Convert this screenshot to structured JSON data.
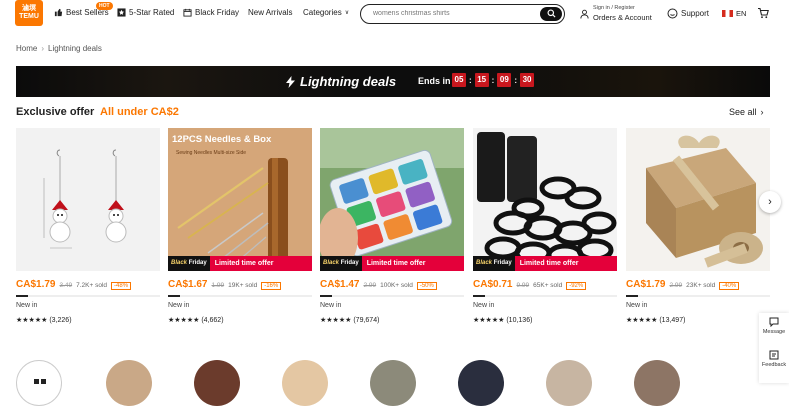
{
  "header": {
    "logo_lines": [
      "滷塓",
      "TEMU"
    ],
    "hot_badge": "HOT",
    "nav": {
      "best_sellers": "Best Sellers",
      "five_star": "5-Star Rated",
      "black_friday": "Black Friday",
      "new_arrivals": "New Arrivals",
      "categories": "Categories"
    },
    "search": {
      "value": "womens christmas shirts"
    },
    "account": {
      "line1": "Sign in / Register",
      "line2": "Orders & Account"
    },
    "support": "Support",
    "language": "EN"
  },
  "breadcrumb": {
    "home": "Home",
    "current": "Lightning deals"
  },
  "banner": {
    "title": "Lightning deals",
    "ends_label": "Ends in",
    "timer": [
      "05",
      "15",
      "09",
      "30"
    ]
  },
  "section": {
    "title": "Exclusive offer",
    "subtitle": "All under CA$2",
    "see_all": "See all"
  },
  "badge": {
    "black": "Black",
    "friday": "Friday",
    "offer": "Limited time offer"
  },
  "products": [
    {
      "price": "CA$1.79",
      "orig": "3.49",
      "sold": "7.2K+ sold",
      "discount": "-48%",
      "new_in": "New in",
      "stars": "★★★★★",
      "reviews": "(3,226)",
      "promo": false,
      "sale_bar": 0.08
    },
    {
      "price": "CA$1.67",
      "orig": "1.99",
      "sold": "19K+ sold",
      "discount": "-16%",
      "new_in": "New in",
      "stars": "★★★★★",
      "reviews": "(4,662)",
      "promo": true,
      "sale_bar": 0.08,
      "img_title": "12PCS Needles & Box",
      "img_sub": "Sewing Needles Multi-size Side"
    },
    {
      "price": "CA$1.47",
      "orig": "2.99",
      "sold": "100K+ sold",
      "discount": "-50%",
      "new_in": "New in",
      "stars": "★★★★★",
      "reviews": "(79,674)",
      "promo": true,
      "sale_bar": 0.08
    },
    {
      "price": "CA$0.71",
      "orig": "9.99",
      "sold": "65K+ sold",
      "discount": "-92%",
      "new_in": "New in",
      "stars": "★★★★★",
      "reviews": "(10,136)",
      "promo": true,
      "sale_bar": 0.08
    },
    {
      "price": "CA$1.79",
      "orig": "2.99",
      "sold": "23K+ sold",
      "discount": "-40%",
      "new_in": "New in",
      "stars": "★★★★★",
      "reviews": "(13,497)",
      "promo": false,
      "sale_bar": 0.08
    }
  ],
  "side": {
    "message": "Message",
    "feedback": "Feedback"
  },
  "colors": {
    "accent": "#fb7701",
    "promo_red": "#e4003a",
    "timer_red": "#c8171e"
  }
}
